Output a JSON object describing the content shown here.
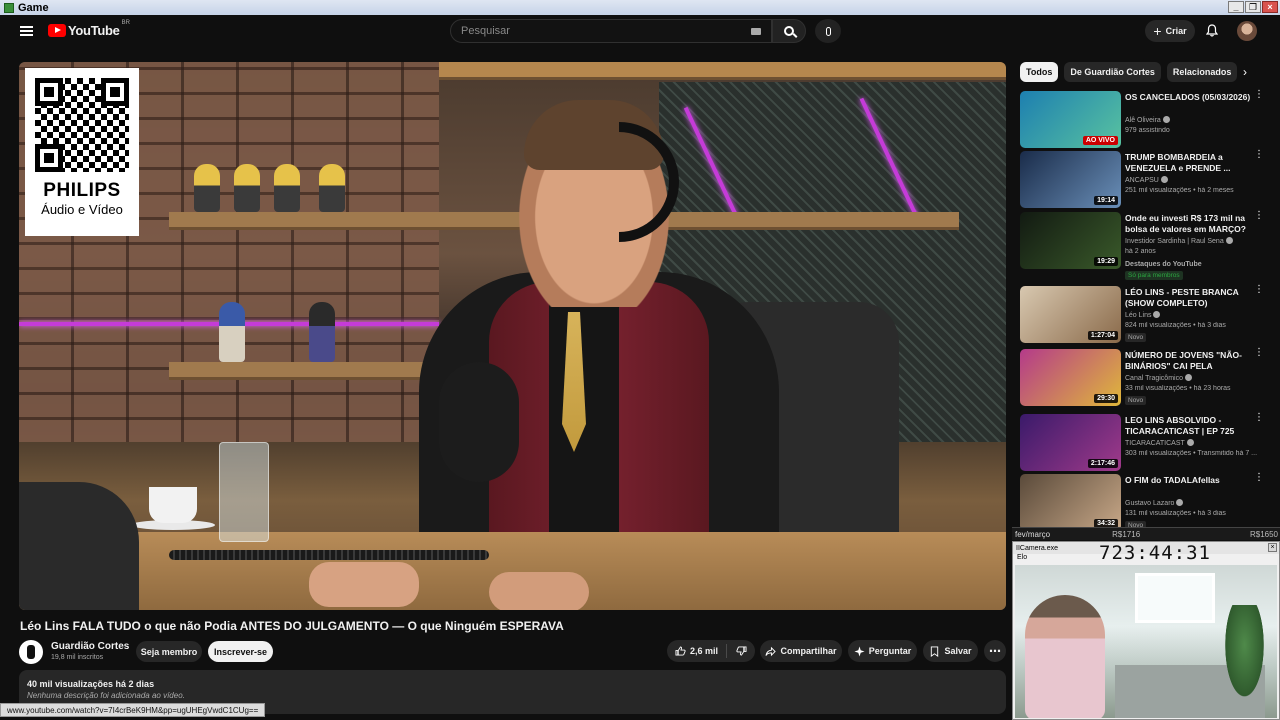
{
  "os_window": {
    "title": "Game"
  },
  "header": {
    "logo_text": "YouTube",
    "country_code": "BR",
    "search_placeholder": "Pesquisar",
    "create_label": "Criar"
  },
  "player": {
    "overlay_brand": "PHILIPS",
    "overlay_sub": "Áudio e Vídeo"
  },
  "video": {
    "title": "Léo Lins FALA TUDO o que não Podia ANTES DO JULGAMENTO — O que Ninguém ESPERAVA",
    "channel_name": "Guardião Cortes",
    "channel_subs": "19,8 mil inscritos",
    "join_label": "Seja membro",
    "subscribe_label": "Inscrever-se",
    "likes": "2,6 mil",
    "share_label": "Compartilhar",
    "ask_label": "Perguntar",
    "save_label": "Salvar",
    "views_time": "40 mil visualizações  há 2 dias",
    "description": "Nenhuma descrição foi adicionada ao vídeo."
  },
  "status_bar": {
    "url": "www.youtube.com/watch?v=7I4crBeK9HM&pp=ugUHEgVwdC1CUg=="
  },
  "chips": [
    {
      "label": "Todos",
      "active": true
    },
    {
      "label": "De Guardião Cortes",
      "active": false
    },
    {
      "label": "Relacionados",
      "active": false
    }
  ],
  "recommendations": [
    {
      "title": "OS CANCELADOS (05/03/2026)",
      "channel": "Alê Oliveira",
      "meta": "979 assistindo",
      "live": "AO VIVO",
      "thumb": "#1d7fb0,#59c3a0"
    },
    {
      "title": "TRUMP BOMBARDEIA a VENEZUELA e PRENDE ...",
      "channel": "ANCAPSU",
      "meta": "251 mil visualizações • há 2 meses",
      "duration": "19:14",
      "thumb": "#1a2c4a,#6a8fb8"
    },
    {
      "title": "Onde eu investi R$ 173 mil na bolsa de valores em MARÇO? ...",
      "channel": "Investidor Sardinha | Raul Sena",
      "meta": "há 2 anos",
      "highlight": "Destaques do YouTube",
      "member": "Só para membros",
      "duration": "19:29",
      "thumb": "#121a12,#3a5a2a"
    },
    {
      "title": "LÉO LINS - PESTE BRANCA (SHOW COMPLETO)",
      "channel": "Léo Lins",
      "meta": "824 mil visualizações • há 3 dias",
      "badge": "Novo",
      "duration": "1:27:04",
      "thumb": "#d8c8b0,#8a6a4a"
    },
    {
      "title": "NÚMERO DE JOVENS \"NÃO-BINÁRIOS\" CAI PELA METADE...",
      "channel": "Canal Tragicômico",
      "meta": "33 mil visualizações • há 23 horas",
      "badge": "Novo",
      "duration": "29:30",
      "thumb": "#b43a8a,#e0b83a"
    },
    {
      "title": "LEO LINS ABSOLVIDO - TICARACATICAST | EP 725",
      "channel": "TICARACATICAST",
      "meta": "303 mil visualizações • Transmitido há 7 ...",
      "duration": "2:17:46",
      "thumb": "#3a1a6a,#a03a8a"
    },
    {
      "title": "O FIM do TADALAfellas",
      "channel": "Gustavo Lazaro",
      "meta": "131 mil visualizações • há 3 dias",
      "badge": "Novo",
      "duration": "34:32",
      "thumb": "#5a4a3a,#c8a888"
    }
  ],
  "overlays": {
    "stock_label": "fev/março",
    "stock_v1": "R$1716",
    "stock_v2": "R$1650",
    "cam_title": "IICamera.exe",
    "cam_menu": "Elo",
    "clock": "723:44:31"
  },
  "colors": {
    "accent_red": "#ff0000",
    "background": "#0f0f0f",
    "chip_bg": "#272727"
  }
}
